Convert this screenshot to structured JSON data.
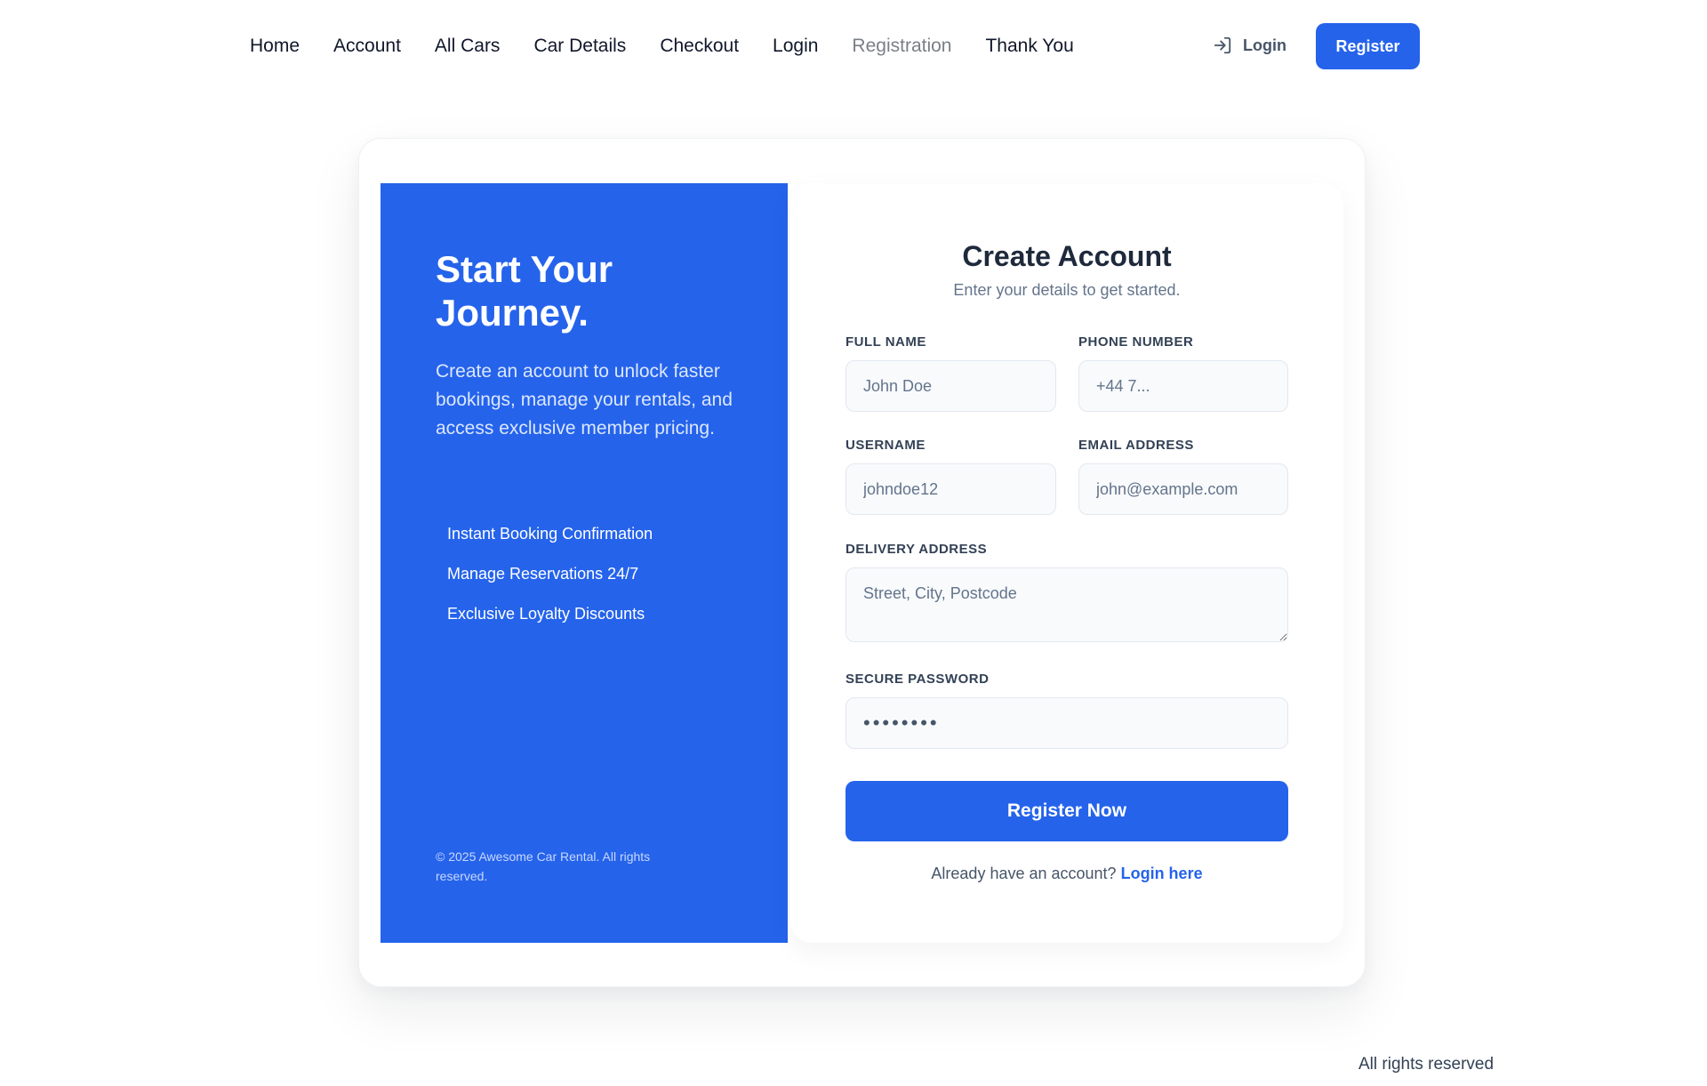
{
  "nav": {
    "links": [
      "Home",
      "Account",
      "All Cars",
      "Car Details",
      "Checkout",
      "Login",
      "Registration",
      "Thank You"
    ],
    "login_label": "Login",
    "register_label": "Register"
  },
  "promo": {
    "title": "Start Your Journey.",
    "text": "Create an account to unlock faster bookings, manage your rentals, and access exclusive member pricing.",
    "features": [
      "Instant Booking Confirmation",
      "Manage Reservations 24/7",
      "Exclusive Loyalty Discounts"
    ],
    "footer": "© 2025 Awesome Car Rental. All rights reserved."
  },
  "form": {
    "title": "Create Account",
    "subtitle": "Enter your details to get started.",
    "full_name": {
      "label": "FULL NAME",
      "placeholder": "John Doe"
    },
    "phone": {
      "label": "PHONE NUMBER",
      "placeholder": "+44 7..."
    },
    "username": {
      "label": "USERNAME",
      "placeholder": "johndoe12"
    },
    "email": {
      "label": "EMAIL ADDRESS",
      "placeholder": "john@example.com"
    },
    "address": {
      "label": "DELIVERY ADDRESS",
      "placeholder": "Street, City, Postcode"
    },
    "password": {
      "label": "SECURE PASSWORD",
      "value": "••••••••"
    },
    "submit_label": "Register Now",
    "login_prompt": "Already have an account?",
    "login_link": "Login here"
  },
  "footer": {
    "text": "All rights reserved"
  },
  "colors": {
    "accent": "#2563eb",
    "input_bg": "#f8fafc",
    "text_dark": "#1e293b"
  },
  "icons": {
    "login": "login-arrow-icon"
  }
}
